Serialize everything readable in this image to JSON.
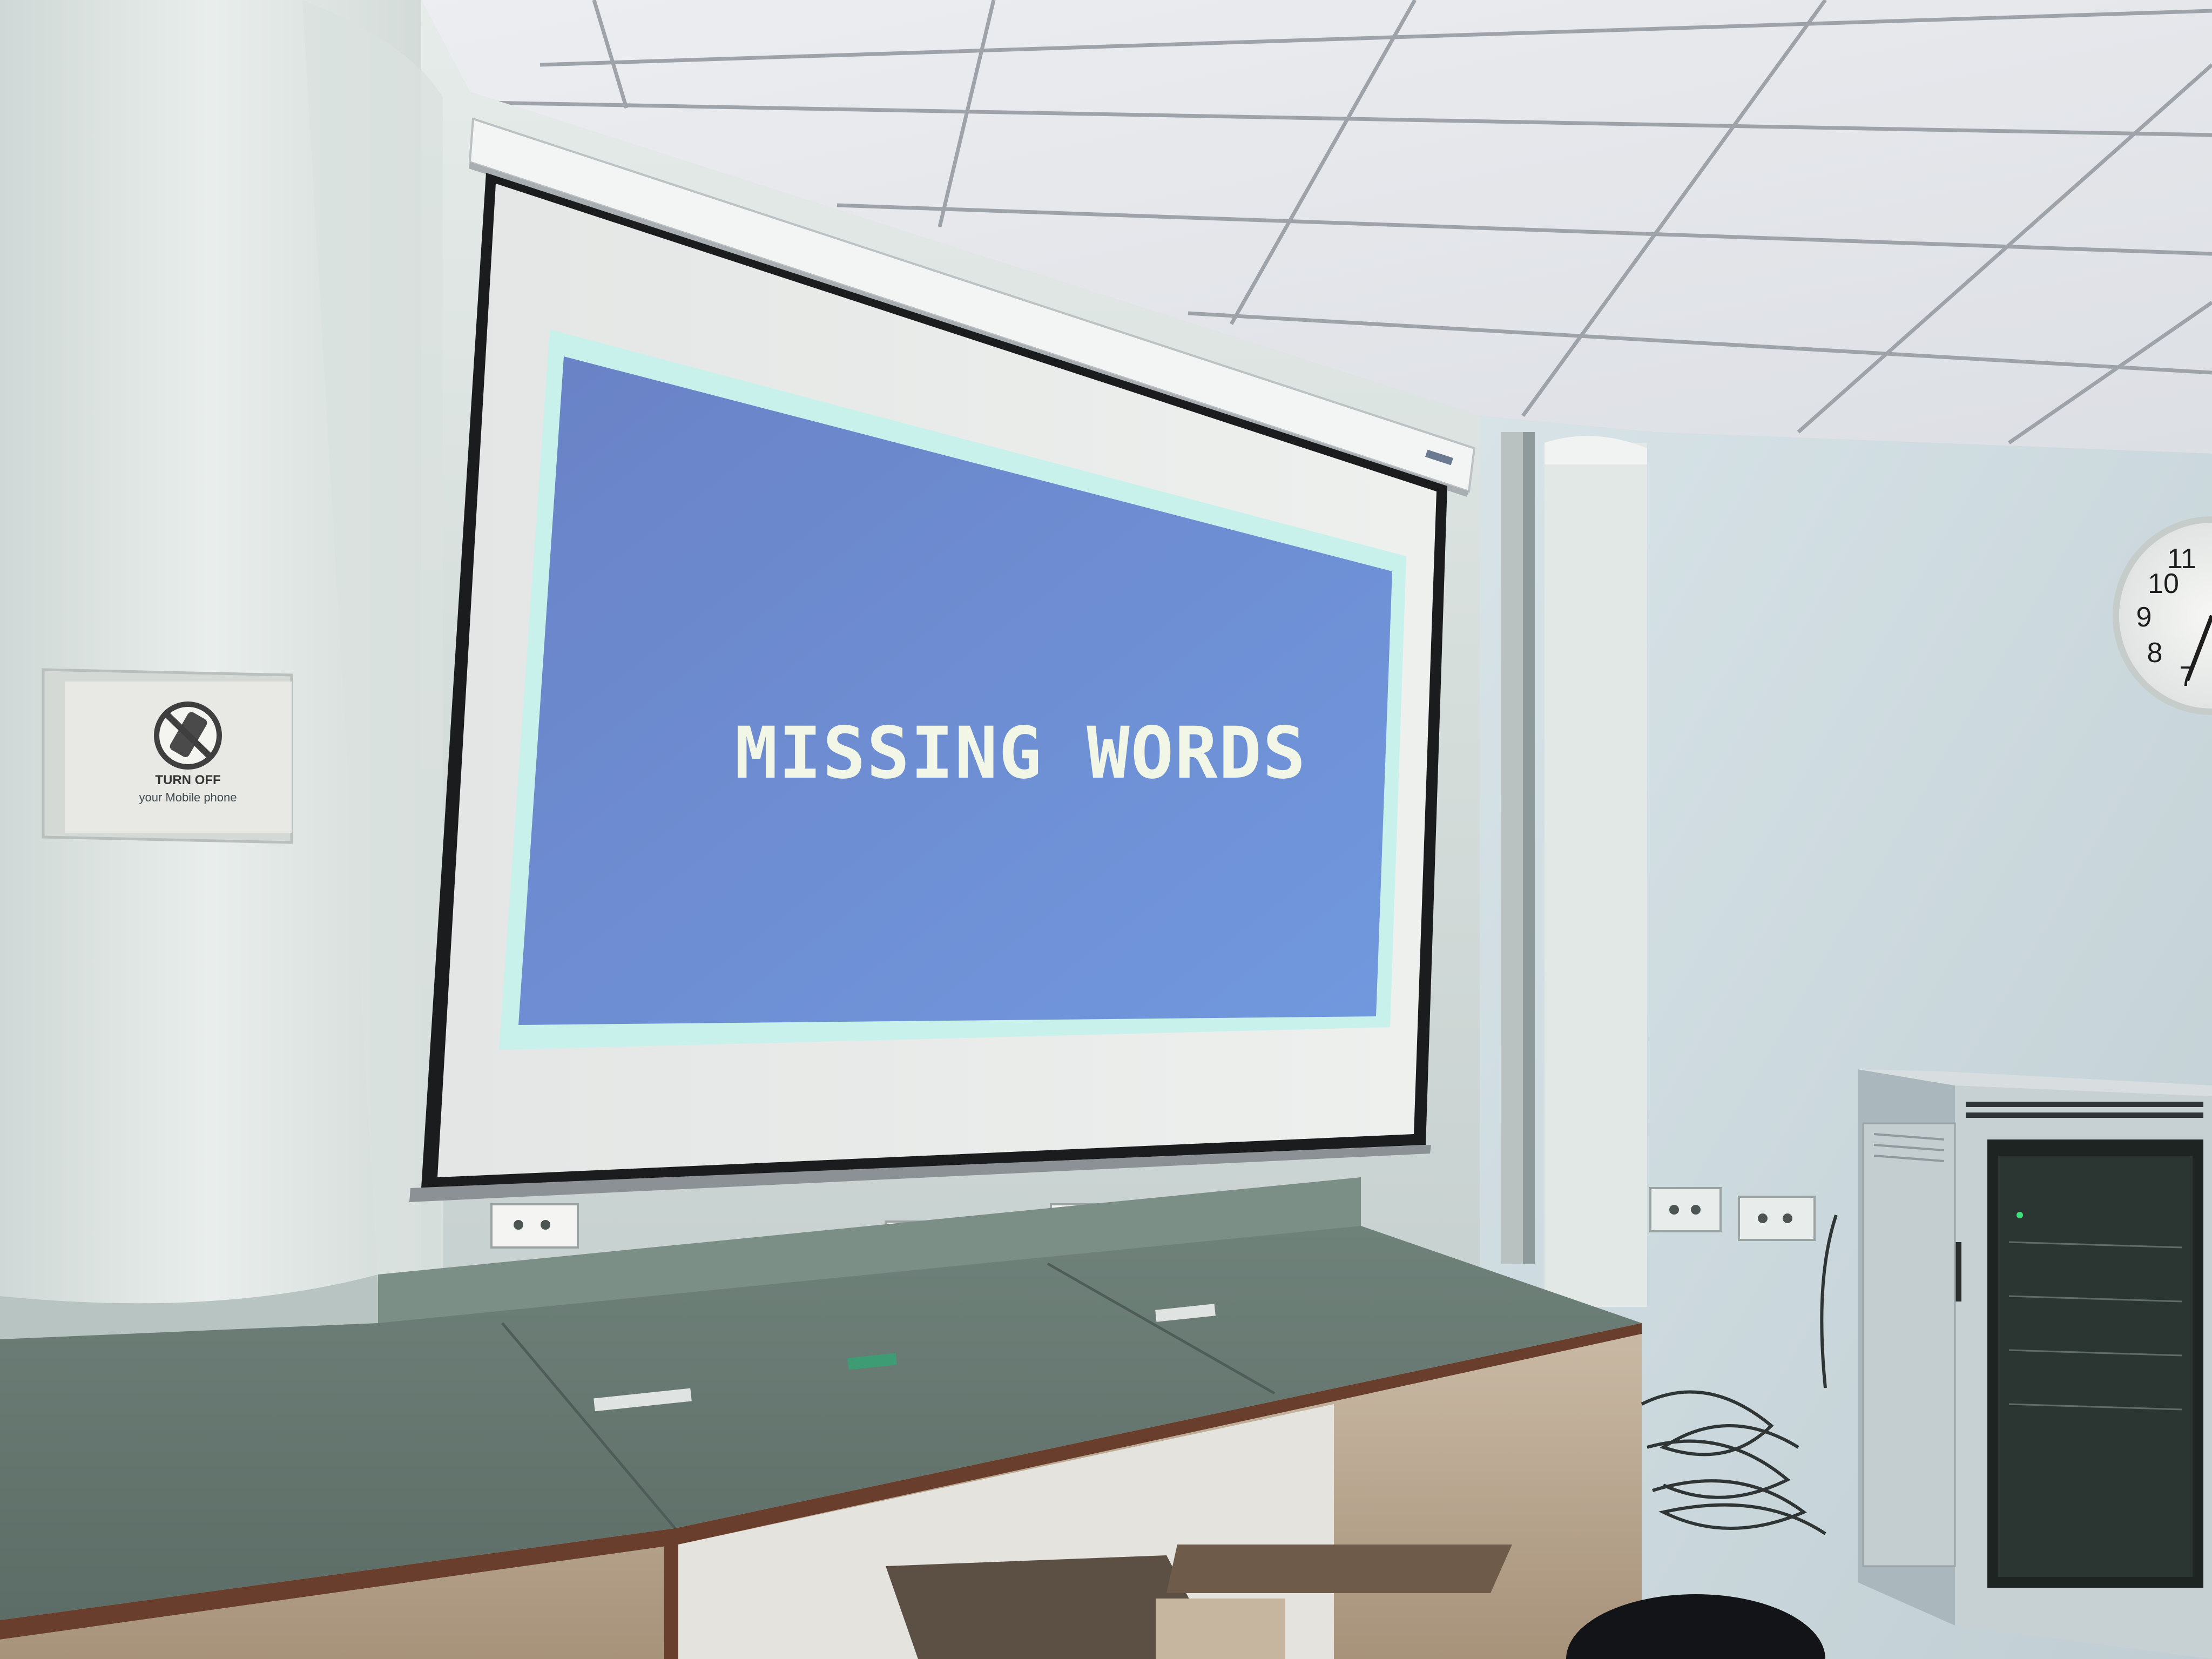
{
  "slide": {
    "title": "MISSING WORDS"
  },
  "wall_sign": {
    "title": "TURN OFF",
    "subtitle": "your Mobile phone"
  },
  "clock": {
    "numbers": [
      "11",
      "10",
      "9",
      "8",
      "7"
    ]
  },
  "colors": {
    "slide_background": "#6f8ed8",
    "slide_border": "#c7f1ea",
    "screen": "#e9ebea",
    "wall": "#dfe6e5",
    "ceiling": "#ecedef",
    "desk_top": "#6d8077",
    "rack": "#c7d0d3"
  }
}
